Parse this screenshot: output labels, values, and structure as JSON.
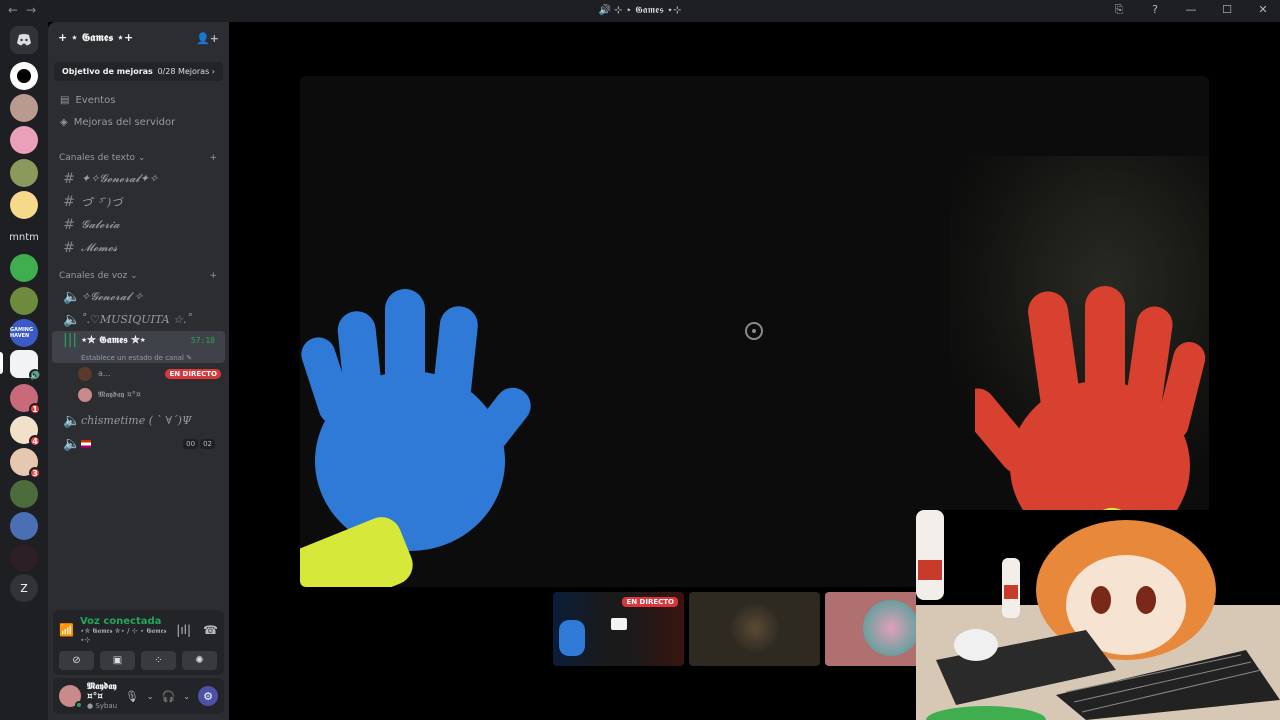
{
  "window": {
    "title": "⊹ ⋆ 𝕲𝖆𝖒𝖊𝖘 ⋆⊹",
    "back": "←",
    "forward": "→",
    "controls": [
      "⎘",
      "?",
      "—",
      "☐",
      "✕"
    ]
  },
  "rail": {
    "text_server": "mntm",
    "letter_server": "Z",
    "badges": [
      "1",
      "4",
      "3"
    ]
  },
  "server": {
    "name": "+ ⋆ 𝕲𝖆𝖒𝖊𝖘 ⋆+",
    "goal_label": "Objetivo de mejoras",
    "goal_value": "0/28 Mejoras",
    "events": "Eventos",
    "boosts": "Mejoras del servidor"
  },
  "text_category": "Canales de texto",
  "text_channels": [
    "✦✧𝓖𝓮𝓷𝓮𝓻𝓪𝓵✦✧",
    "づ ̄ ³ ̄)づ",
    "𝓖𝓪𝓵𝓮𝓻𝓲𝓪",
    "𝓜𝓮𝓶𝓮𝓼"
  ],
  "voice_category": "Canales de voz",
  "voice_channels": {
    "general": "✧𝓖𝓮𝓷𝓮𝓻𝓪𝓵 ✧",
    "musiquita": "˚.♡MUSIQUITA ☆.˚",
    "active_name": "⋆✮ 𝕲𝖆𝖒𝖊𝖘 ✮⋆",
    "active_timer": "57:18",
    "active_status": "Establece un estado de canal",
    "member1": "a...",
    "member1_live": "EN DIRECTO",
    "member2": "𝕸𝖆𝖞𝖉𝖆𝖞 ¤°¤",
    "chismetime": "chismetime ( ˋ ∀ˊ)Ψ",
    "flag_counts": [
      "00",
      "02"
    ]
  },
  "voice_panel": {
    "status": "Voz conectada",
    "sub": "⋆✮ 𝕲𝖆𝖒𝖊𝖘 ✮⋆ / ⊹ ⋆ 𝕲𝖆𝖒𝖊𝖘 ⋆⊹"
  },
  "user": {
    "name": "𝕸𝖆𝖞𝖉𝖆𝖞 ¤°¤",
    "status": "Sybau"
  },
  "stream": {
    "thumb_live": "EN DIRECTO"
  },
  "colors": {
    "rail_bg": "#1e1f22",
    "sidebar_bg": "#2b2d31",
    "live_red": "#da373c",
    "voice_green": "#23a55a",
    "blue_hand": "#2f7ad6",
    "red_hand": "#d8402f",
    "cuff_yellow": "#d6e93a"
  }
}
